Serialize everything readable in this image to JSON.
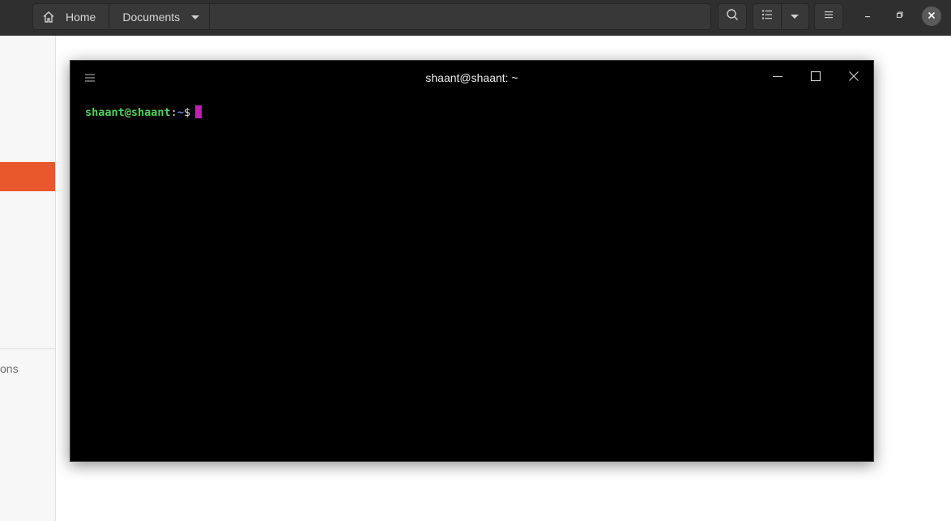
{
  "file_manager": {
    "pathbar": {
      "home_label": "Home",
      "current_label": "Documents"
    },
    "sidebar": {
      "partial_item_label": "ons"
    },
    "accent_color": "#e9582c"
  },
  "terminal": {
    "title": "shaant@shaant: ~",
    "prompt": {
      "user_host": "shaant@shaant",
      "separator": ":",
      "path": "~",
      "symbol": "$"
    },
    "colors": {
      "user_host": "#4fd35a",
      "path": "#5d8fe0",
      "cursor": "#c21fb0",
      "background": "#000000"
    }
  },
  "icons": {
    "home": "home-icon",
    "dropdown": "chevron-down-icon",
    "search": "search-icon",
    "list_view": "list-view-icon",
    "view_options": "chevron-down-icon",
    "menu": "hamburger-menu-icon",
    "minimize": "minimize-icon",
    "maximize": "maximize-icon",
    "close": "close-icon"
  }
}
